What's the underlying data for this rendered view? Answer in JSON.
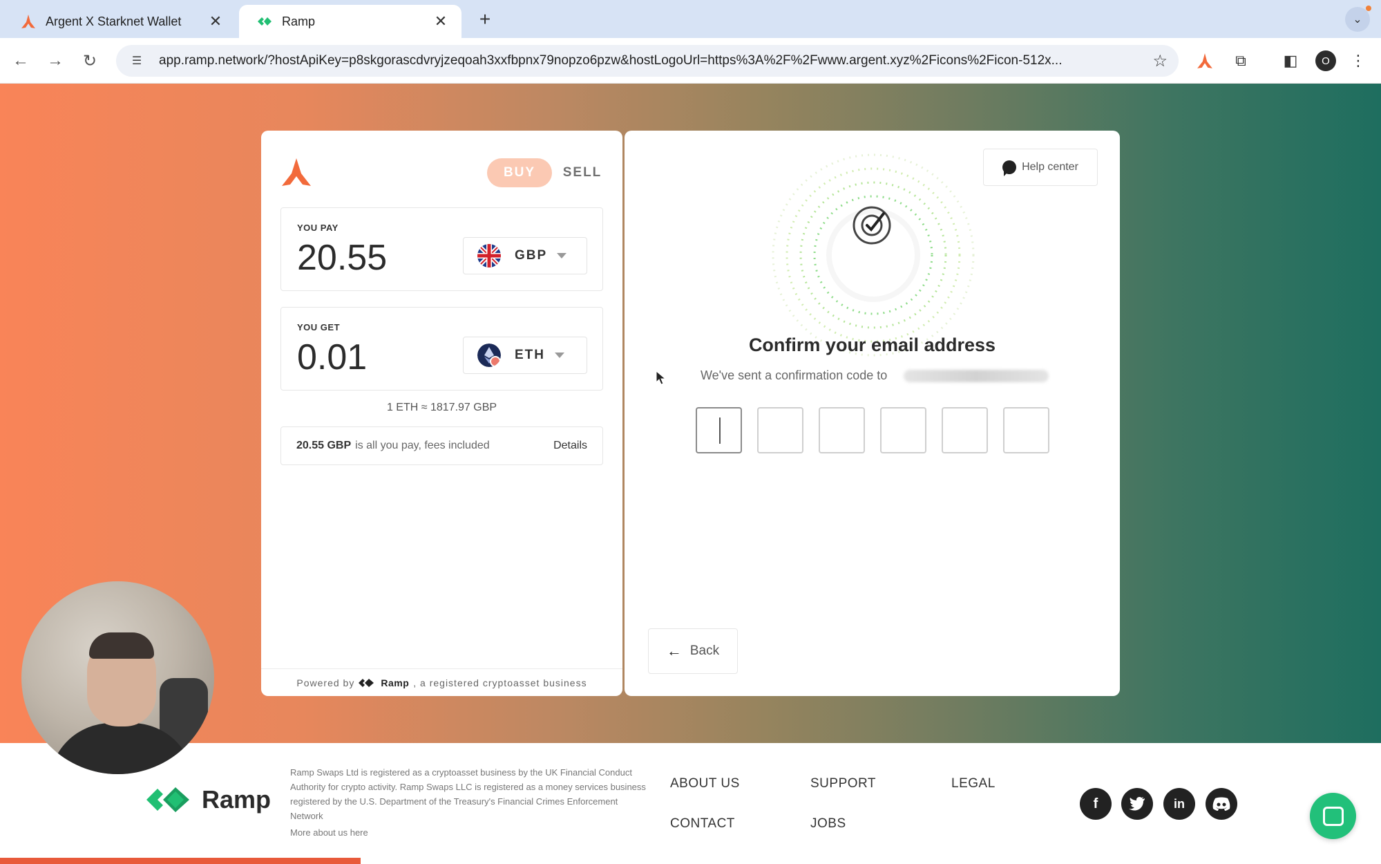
{
  "browser": {
    "tabs": [
      {
        "title": "Argent X Starknet Wallet",
        "active": false
      },
      {
        "title": "Ramp",
        "active": true
      }
    ],
    "new_tab": "+",
    "url": "app.ramp.network/?hostApiKey=p8skgorascdvryjzeqoah3xxfbpnx79nopzo6pzw&hostLogoUrl=https%3A%2F%2Fwww.argent.xyz%2Ficons%2Ficon-512x...",
    "profile_initial": "O"
  },
  "widget": {
    "modes": {
      "buy": "BUY",
      "sell": "SELL"
    },
    "pay": {
      "label": "YOU PAY",
      "amount": "20.55",
      "currency": "GBP"
    },
    "get": {
      "label": "YOU GET",
      "amount": "0.01",
      "currency": "ETH"
    },
    "rate": "1 ETH ≈ 1817.97 GBP",
    "fees": {
      "amount": "20.55 GBP",
      "text": "is all you pay, fees included",
      "details": "Details"
    },
    "powered_prefix": "Powered by",
    "powered_brand": "Ramp",
    "powered_suffix": ", a registered cryptoasset business"
  },
  "confirm": {
    "help_center": "Help center",
    "title": "Confirm your email address",
    "subtitle": "We've sent a confirmation code to",
    "code_length": 6,
    "back": "Back"
  },
  "footer": {
    "brand": "Ramp",
    "legal": "Ramp Swaps Ltd is registered as a cryptoasset business by the UK Financial Conduct Authority for crypto activity. Ramp Swaps LLC is registered as a money services business registered by the U.S. Department of the Treasury's Financial Crimes Enforcement Network",
    "more": "More about us here",
    "links": {
      "about": "ABOUT US",
      "support": "SUPPORT",
      "legal": "LEGAL",
      "contact": "CONTACT",
      "jobs": "JOBS"
    },
    "social": [
      "facebook-icon",
      "twitter-icon",
      "linkedin-icon",
      "discord-icon"
    ]
  },
  "colors": {
    "accent": "#f26a3b",
    "ramp_green": "#21bf73",
    "buy_pill": "#fbc9b3"
  }
}
